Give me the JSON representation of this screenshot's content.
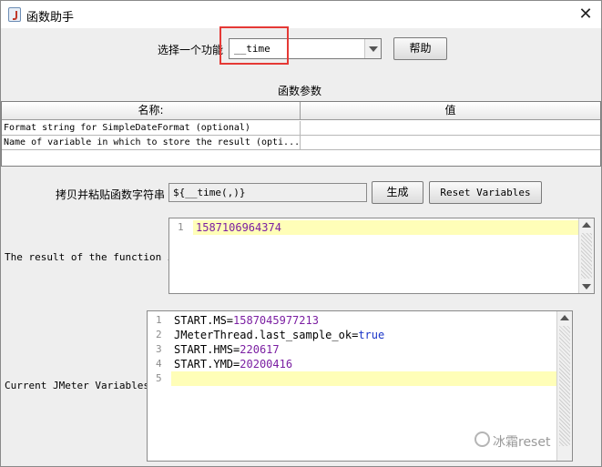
{
  "window": {
    "title": "函数助手",
    "close_glyph": "✕"
  },
  "function_select": {
    "label": "选择一个功能",
    "value": "__time",
    "help_label": "帮助"
  },
  "parameters": {
    "title": "函数参数",
    "columns": [
      "名称:",
      "值"
    ],
    "rows": [
      {
        "name": "Format string for SimpleDateFormat (optional)",
        "value": ""
      },
      {
        "name": "Name of variable in which to store the result (opti...",
        "value": ""
      }
    ]
  },
  "copy": {
    "label": "拷贝并粘贴函数字符串",
    "value": "${__time(,)}",
    "generate_label": "生成",
    "reset_label": "Reset Variables"
  },
  "result": {
    "label": "The result of the function is",
    "lines": [
      {
        "num": "1",
        "text": "1587106964374"
      }
    ]
  },
  "variables": {
    "label": "Current JMeter Variables",
    "lines": [
      {
        "num": "1",
        "key": "START.MS",
        "eq": "=",
        "val": "1587045977213"
      },
      {
        "num": "2",
        "key": "JMeterThread.last_sample_ok",
        "eq": "=",
        "val": "true"
      },
      {
        "num": "3",
        "key": "START.HMS",
        "eq": "=",
        "val": "220617"
      },
      {
        "num": "4",
        "key": "START.YMD",
        "eq": "=",
        "val": "20200416"
      },
      {
        "num": "5",
        "key": "",
        "eq": "",
        "val": ""
      }
    ]
  },
  "watermark": {
    "text": "冰霜reset"
  },
  "colors": {
    "highlight_border": "#e53935",
    "current_line": "#fffeb8",
    "number_literal": "#7b1fa2",
    "boolean_literal": "#1a35c8"
  }
}
